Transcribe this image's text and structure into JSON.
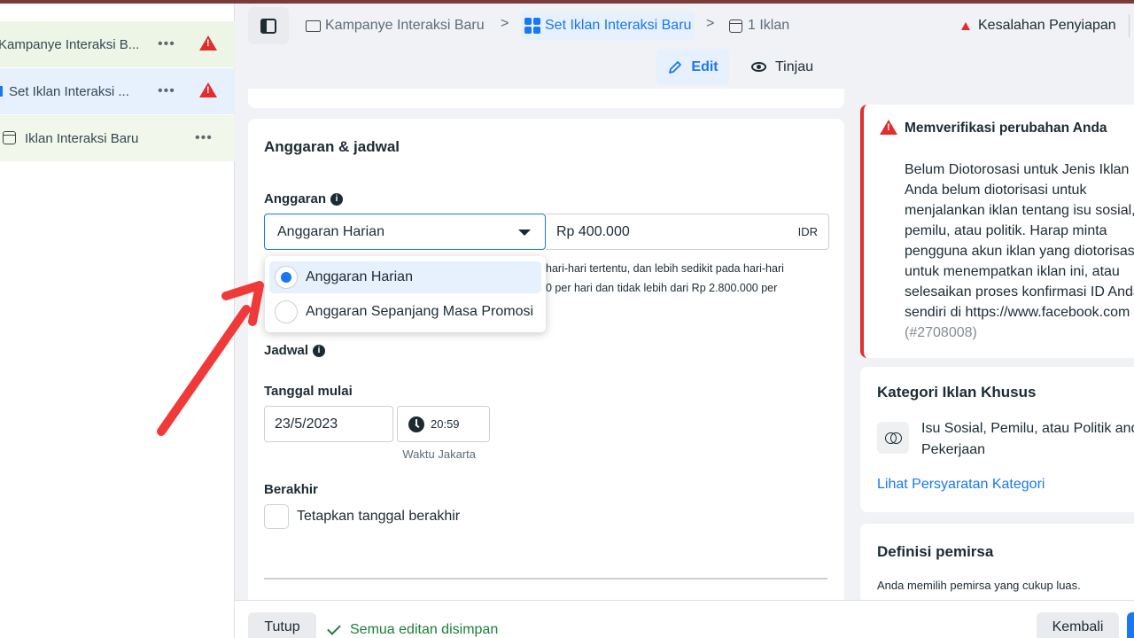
{
  "sidebar": {
    "items": [
      {
        "label": "Kampanye Interaksi B...",
        "more": "•••",
        "warning": true
      },
      {
        "label": "Set Iklan Interaksi ...",
        "more": "•••",
        "warning": true
      },
      {
        "label": "Iklan Interaksi Baru",
        "more": "•••",
        "warning": false
      }
    ]
  },
  "breadcrumb": {
    "campaign": "Kampanye Interaksi Baru",
    "adset": "Set Iklan Interaksi Baru",
    "ads": "1 Iklan",
    "separator": ">"
  },
  "status": {
    "error": "Kesalahan Penyiapan"
  },
  "modes": {
    "edit": "Edit",
    "review": "Tinjau"
  },
  "budget_section": {
    "title": "Anggaran & jadwal",
    "budget_label": "Anggaran",
    "budget_type": "Anggaran Harian",
    "amount": "Rp 400.000",
    "currency": "IDR",
    "helper_line1": "hari-hari tertentu, dan lebih sedikit pada hari-hari",
    "helper_line2": "0 per hari dan tidak lebih dari Rp 2.800.000 per",
    "options": [
      "Anggaran Harian",
      "Anggaran Sepanjang Masa Promosi"
    ],
    "selected_option": 0,
    "schedule_label": "Jadwal",
    "start_label": "Tanggal mulai",
    "start_date": "23/5/2023",
    "start_time": "20:59",
    "timezone": "Waktu Jakarta",
    "end_label": "Berakhir",
    "end_checkbox": "Tetapkan tanggal berakhir"
  },
  "alert": {
    "title": "Memverifikasi perubahan Anda",
    "lines": [
      "Belum Diotorosasi untuk Jenis Iklan I",
      "Anda belum diotorisasi untuk",
      "menjalankan iklan tentang isu sosial,",
      "pemilu, atau politik. Harap minta",
      "pengguna akun iklan yang diotorisasi",
      "untuk menempatkan iklan ini, atau",
      "selesaikan proses konfirmasi ID Anda",
      "sendiri di https://www.facebook.com",
      "(#2708008)"
    ]
  },
  "special_category": {
    "title": "Kategori Iklan Khusus",
    "value_line1": "Isu Sosial, Pemilu, atau Politik and",
    "value_line2": "Pekerjaan",
    "link": "Lihat Persyaratan Kategori"
  },
  "audience": {
    "title": "Definisi pemirsa",
    "subtitle": "Anda memilih pemirsa yang cukup luas."
  },
  "footer": {
    "close": "Tutup",
    "saved": "Semua editan disimpan",
    "back": "Kembali"
  },
  "colors": {
    "accent": "#1877f2",
    "error": "#e02e2e",
    "annotation_arrow": "#f03a3a"
  }
}
